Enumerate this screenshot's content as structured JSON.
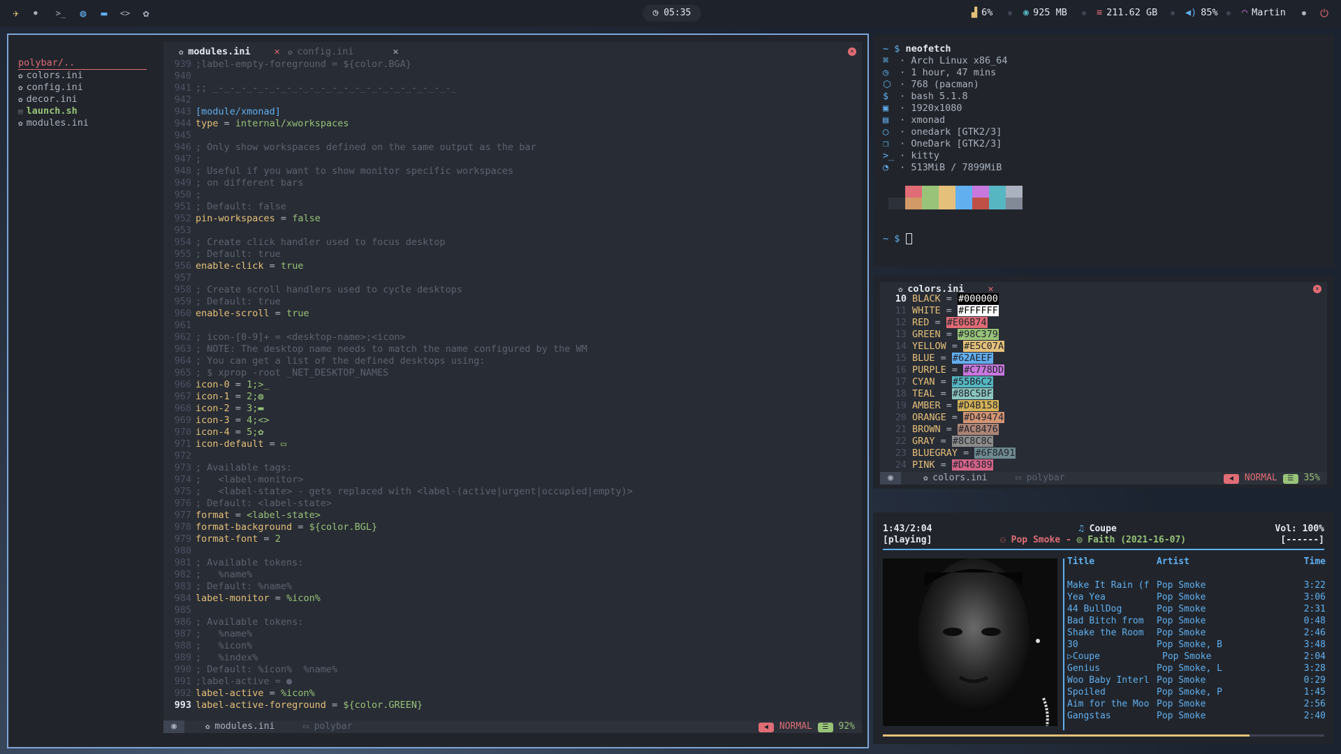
{
  "topbar": {
    "launcher_icon": "rocket-icon",
    "workspace_icons": [
      "terminal-icon",
      "globe-icon",
      "folder-icon",
      "code-icon",
      "gear-icon"
    ],
    "clock": "05:35",
    "cpu": "6%",
    "ram": "925 MB",
    "disk": "211.62 GB",
    "volume": "85%",
    "wifi": "Martin"
  },
  "editor": {
    "tree": {
      "root": "polybar/..",
      "items": [
        {
          "label": "colors.ini",
          "highlight": false
        },
        {
          "label": "config.ini",
          "highlight": false
        },
        {
          "label": "decor.ini",
          "highlight": false
        },
        {
          "label": "launch.sh",
          "highlight": true
        },
        {
          "label": "modules.ini",
          "highlight": false
        }
      ]
    },
    "tabs": [
      {
        "label": "modules.ini",
        "active": true
      },
      {
        "label": "config.ini",
        "active": false
      }
    ],
    "lines": [
      {
        "n": "939",
        "text": ";label-empty-foreground = ${color.BGA}",
        "kind": "com"
      },
      {
        "n": "940",
        "text": "",
        "kind": "txt"
      },
      {
        "n": "941",
        "text": ";; _-_-_-_-_-_-_-_-_-_-_-_-_-_-_-_-_-_-_-_-_-_",
        "kind": "com"
      },
      {
        "n": "942",
        "text": "",
        "kind": "txt"
      },
      {
        "n": "943",
        "text": "[module/xmonad]",
        "kind": "sec"
      },
      {
        "n": "944",
        "key": "type",
        "val": "internal/xworkspaces",
        "kind": "kv"
      },
      {
        "n": "945",
        "text": "",
        "kind": "txt"
      },
      {
        "n": "946",
        "text": "; Only show workspaces defined on the same output as the bar",
        "kind": "com"
      },
      {
        "n": "947",
        "text": ";",
        "kind": "com"
      },
      {
        "n": "948",
        "text": "; Useful if you want to show monitor specific workspaces",
        "kind": "com"
      },
      {
        "n": "949",
        "text": "; on different bars",
        "kind": "com"
      },
      {
        "n": "950",
        "text": ";",
        "kind": "com"
      },
      {
        "n": "951",
        "text": "; Default: false",
        "kind": "com"
      },
      {
        "n": "952",
        "key": "pin-workspaces",
        "val": "false",
        "kind": "kv"
      },
      {
        "n": "953",
        "text": "",
        "kind": "txt"
      },
      {
        "n": "954",
        "text": "; Create click handler used to focus desktop",
        "kind": "com"
      },
      {
        "n": "955",
        "text": "; Default: true",
        "kind": "com"
      },
      {
        "n": "956",
        "key": "enable-click",
        "val": "true",
        "kind": "kv"
      },
      {
        "n": "957",
        "text": "",
        "kind": "txt"
      },
      {
        "n": "958",
        "text": "; Create scroll handlers used to cycle desktops",
        "kind": "com"
      },
      {
        "n": "959",
        "text": "; Default: true",
        "kind": "com"
      },
      {
        "n": "960",
        "key": "enable-scroll",
        "val": "true",
        "kind": "kv"
      },
      {
        "n": "961",
        "text": "",
        "kind": "txt"
      },
      {
        "n": "962",
        "text": "; icon-[0-9]+ = <desktop-name>;<icon>",
        "kind": "com"
      },
      {
        "n": "963",
        "text": "; NOTE: The desktop name needs to match the name configured by the WM",
        "kind": "com"
      },
      {
        "n": "964",
        "text": "; You can get a list of the defined desktops using:",
        "kind": "com"
      },
      {
        "n": "965",
        "text": "; $ xprop -root _NET_DESKTOP_NAMES",
        "kind": "com"
      },
      {
        "n": "966",
        "key": "icon-0",
        "val": "1;>_",
        "kind": "kv"
      },
      {
        "n": "967",
        "key": "icon-1",
        "val": "2;◍",
        "kind": "kv"
      },
      {
        "n": "968",
        "key": "icon-2",
        "val": "3;▬",
        "kind": "kv"
      },
      {
        "n": "969",
        "key": "icon-3",
        "val": "4;<>",
        "kind": "kv"
      },
      {
        "n": "970",
        "key": "icon-4",
        "val": "5;✿",
        "kind": "kv"
      },
      {
        "n": "971",
        "key": "icon-default",
        "val": "▭",
        "kind": "kv"
      },
      {
        "n": "972",
        "text": "",
        "kind": "txt"
      },
      {
        "n": "973",
        "text": "; Available tags:",
        "kind": "com"
      },
      {
        "n": "974",
        "text": ";   <label-monitor>",
        "kind": "com"
      },
      {
        "n": "975",
        "text": ";   <label-state> - gets replaced with <label-(active|urgent|occupied|empty)>",
        "kind": "com"
      },
      {
        "n": "976",
        "text": "; Default: <label-state>",
        "kind": "com"
      },
      {
        "n": "977",
        "key": "format",
        "val": "<label-state>",
        "kind": "kv"
      },
      {
        "n": "978",
        "key": "format-background",
        "val": "${color.BGL}",
        "kind": "kv"
      },
      {
        "n": "979",
        "key": "format-font",
        "val": "2",
        "kind": "kv"
      },
      {
        "n": "980",
        "text": "",
        "kind": "txt"
      },
      {
        "n": "981",
        "text": "; Available tokens:",
        "kind": "com"
      },
      {
        "n": "982",
        "text": ";   %name%",
        "kind": "com"
      },
      {
        "n": "983",
        "text": "; Default: %name%",
        "kind": "com"
      },
      {
        "n": "984",
        "key": "label-monitor",
        "val": "%icon%",
        "kind": "kv"
      },
      {
        "n": "985",
        "text": "",
        "kind": "txt"
      },
      {
        "n": "986",
        "text": "; Available tokens:",
        "kind": "com"
      },
      {
        "n": "987",
        "text": ";   %name%",
        "kind": "com"
      },
      {
        "n": "988",
        "text": ";   %icon%",
        "kind": "com"
      },
      {
        "n": "989",
        "text": ";   %index%",
        "kind": "com"
      },
      {
        "n": "990",
        "text": "; Default: %icon%  %name%",
        "kind": "com"
      },
      {
        "n": "991",
        "text": ";label-active = ●",
        "kind": "com"
      },
      {
        "n": "992",
        "key": "label-active",
        "val": "%icon%",
        "kind": "kv"
      },
      {
        "n": "993",
        "key": "label-active-foreground",
        "val": "${color.GREEN}",
        "kind": "kv",
        "current": true
      }
    ],
    "status": {
      "file": "modules.ini",
      "dir": "polybar",
      "mode": "NORMAL",
      "percent": "92%"
    }
  },
  "terminal": {
    "prompt": "~ $",
    "command": "neofetch",
    "info": [
      {
        "icon": "⌘",
        "text": "Arch Linux x86_64"
      },
      {
        "icon": "◷",
        "text": "1 hour, 47 mins"
      },
      {
        "icon": "⬡",
        "text": "768 (pacman)"
      },
      {
        "icon": "$",
        "text": "bash 5.1.8"
      },
      {
        "icon": "▣",
        "text": "1920x1080"
      },
      {
        "icon": "▤",
        "text": "xmonad"
      },
      {
        "icon": "◯",
        "text": "onedark [GTK2/3]"
      },
      {
        "icon": "❐",
        "text": "OneDark [GTK2/3]"
      },
      {
        "icon": ">_",
        "text": "kitty"
      },
      {
        "icon": "◔",
        "text": "513MiB / 7899MiB"
      }
    ],
    "swatches_top": [
      "#21252b",
      "#e06c75",
      "#98c379",
      "#e5c07b",
      "#61afef",
      "#c678dd",
      "#56b6c2",
      "#abb2bf"
    ],
    "swatches_bottom": [
      "#2c313a",
      "#d19a66",
      "#98c379",
      "#e5c07b",
      "#61afef",
      "#be5046",
      "#56b6c2",
      "#828997"
    ],
    "prompt2": "~ $"
  },
  "colors_file": {
    "tab": "colors.ini",
    "rows": [
      {
        "n": "10",
        "name": "BLACK",
        "hex": "#000000",
        "bg": "#000000",
        "fg": "#ffffff"
      },
      {
        "n": "11",
        "name": "WHITE",
        "hex": "#FFFFFF",
        "bg": "#ffffff",
        "fg": "#000000"
      },
      {
        "n": "12",
        "name": "RED",
        "hex": "#E06B74",
        "bg": "#e06b74",
        "fg": "#21252b"
      },
      {
        "n": "13",
        "name": "GREEN",
        "hex": "#98C379",
        "bg": "#98c379",
        "fg": "#21252b"
      },
      {
        "n": "14",
        "name": "YELLOW",
        "hex": "#E5C07A",
        "bg": "#e5c07a",
        "fg": "#21252b"
      },
      {
        "n": "15",
        "name": "BLUE",
        "hex": "#62AEEF",
        "bg": "#62aeef",
        "fg": "#21252b"
      },
      {
        "n": "16",
        "name": "PURPLE",
        "hex": "#C778DD",
        "bg": "#c778dd",
        "fg": "#21252b"
      },
      {
        "n": "17",
        "name": "CYAN",
        "hex": "#55B6C2",
        "bg": "#55b6c2",
        "fg": "#21252b"
      },
      {
        "n": "18",
        "name": "TEAL",
        "hex": "#8BC5BF",
        "bg": "#8bc5bf",
        "fg": "#21252b"
      },
      {
        "n": "19",
        "name": "AMBER",
        "hex": "#D4B158",
        "bg": "#d4b158",
        "fg": "#21252b"
      },
      {
        "n": "20",
        "name": "ORANGE",
        "hex": "#D49474",
        "bg": "#d49474",
        "fg": "#21252b"
      },
      {
        "n": "21",
        "name": "BROWN",
        "hex": "#AC8476",
        "bg": "#ac8476",
        "fg": "#21252b"
      },
      {
        "n": "22",
        "name": "GRAY",
        "hex": "#8C8C8C",
        "bg": "#8c8c8c",
        "fg": "#21252b"
      },
      {
        "n": "23",
        "name": "BLUEGRAY",
        "hex": "#6F8A91",
        "bg": "#6f8a91",
        "fg": "#21252b"
      },
      {
        "n": "24",
        "name": "PINK",
        "hex": "#D46389",
        "bg": "#d46389",
        "fg": "#21252b"
      }
    ],
    "status": {
      "file": "colors.ini",
      "dir": "polybar",
      "mode": "NORMAL",
      "percent": "35%"
    }
  },
  "music": {
    "elapsed": "1:43/2:04",
    "state": "[playing]",
    "song": "Coupe",
    "artist": "Pop Smoke",
    "separator": "-",
    "album": "Faith (2021-16-07)",
    "volume": "Vol: 100%",
    "flags": "[------]",
    "progress": 0.83,
    "columns": {
      "title": "Title",
      "artist": "Artist",
      "time": "Time"
    },
    "tracks": [
      {
        "title": "Make It Rain (f",
        "artist": "Pop Smoke",
        "time": "3:22",
        "playing": false
      },
      {
        "title": "Yea Yea",
        "artist": "Pop Smoke",
        "time": "3:06",
        "playing": false
      },
      {
        "title": "44 BullDog",
        "artist": "Pop Smoke",
        "time": "2:31",
        "playing": false
      },
      {
        "title": "Bad Bitch from",
        "artist": "Pop Smoke",
        "time": "0:48",
        "playing": false
      },
      {
        "title": "Shake the Room",
        "artist": "Pop Smoke",
        "time": "2:46",
        "playing": false
      },
      {
        "title": "30",
        "artist": "Pop Smoke, B",
        "time": "3:48",
        "playing": false
      },
      {
        "title": "Coupe",
        "artist": "Pop Smoke",
        "time": "2:04",
        "playing": true
      },
      {
        "title": "Genius",
        "artist": "Pop Smoke, L",
        "time": "3:28",
        "playing": false
      },
      {
        "title": "Woo Baby Interl",
        "artist": "Pop Smoke",
        "time": "0:29",
        "playing": false
      },
      {
        "title": "Spoiled",
        "artist": "Pop Smoke, P",
        "time": "1:45",
        "playing": false
      },
      {
        "title": "Aim for the Moo",
        "artist": "Pop Smoke",
        "time": "2:56",
        "playing": false
      },
      {
        "title": "Gangstas",
        "artist": "Pop Smoke",
        "time": "2:40",
        "playing": false
      }
    ]
  }
}
